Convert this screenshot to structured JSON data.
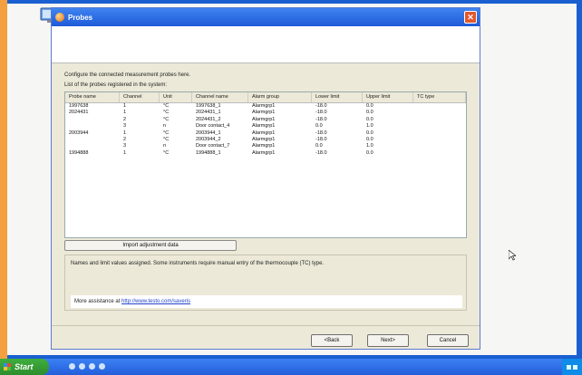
{
  "window": {
    "title": "Probes",
    "close_glyph": "✕"
  },
  "intro": "Configure the connected measurement probes here.",
  "list_label": "List of the probes registered in the system:",
  "table": {
    "columns": [
      "Probe name",
      "Channel",
      "Unit",
      "Channel name",
      "Alarm group",
      "Lower limit",
      "Upper limit",
      "TC type"
    ],
    "rows": [
      [
        "1997638",
        "1",
        "°C",
        "1997638_1",
        "Alarmgrp1",
        "-18.0",
        "0.0",
        ""
      ],
      [
        "2024431",
        "1",
        "°C",
        "2024431_1",
        "Alarmgrp1",
        "-18.0",
        "0.0",
        ""
      ],
      [
        "",
        "2",
        "°C",
        "2024431_2",
        "Alarmgrp1",
        "-18.0",
        "0.0",
        ""
      ],
      [
        "",
        "3",
        "n",
        "Door contact_4",
        "Alarmgrp1",
        "0.0",
        "1.0",
        ""
      ],
      [
        "2003944",
        "1",
        "°C",
        "2003944_1",
        "Alarmgrp1",
        "-18.0",
        "0.0",
        ""
      ],
      [
        "",
        "2",
        "°C",
        "2003944_2",
        "Alarmgrp1",
        "-18.0",
        "0.0",
        ""
      ],
      [
        "",
        "3",
        "n",
        "Door contact_7",
        "Alarmgrp1",
        "0.0",
        "1.0",
        ""
      ],
      [
        "1994888",
        "1",
        "°C",
        "1994888_1",
        "Alarmgrp1",
        "-18.0",
        "0.0",
        ""
      ]
    ]
  },
  "import_button": "Import adjustment data",
  "info_text": "Names and limit values assigned. Some instruments require manual entry of the thermocouple (TC) type.",
  "assist": {
    "prefix": "More assistance at ",
    "link": "http://www.testo.com/saveris"
  },
  "buttons": {
    "back": "<Back",
    "next": "Next>",
    "cancel": "Cancel"
  },
  "taskbar": {
    "start": "Start"
  },
  "icons": {
    "desktop": "desktop-computer-icon",
    "app": "probe-app-icon",
    "cursor": "mouse-pointer-icon"
  },
  "colors": {
    "desktop": "#1a5fd0",
    "titlebar": "#2a6ae8",
    "dialog": "#ece9d8",
    "close": "#e2572d",
    "start": "#35a035"
  }
}
